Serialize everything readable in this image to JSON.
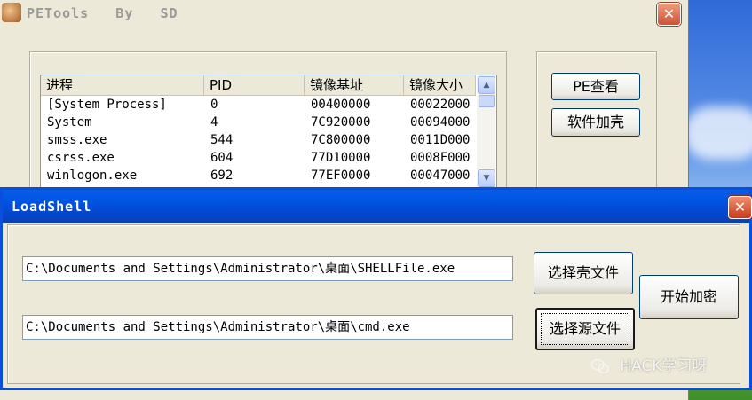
{
  "main_window": {
    "title": "PETools   By   SD",
    "close_glyph": "✕",
    "process_list": {
      "columns": [
        "进程",
        "PID",
        "镜像基址",
        "镜像大小"
      ],
      "rows": [
        [
          "[System Process]",
          "0",
          "00400000",
          "00022000"
        ],
        [
          "System",
          "4",
          "7C920000",
          "00094000"
        ],
        [
          "smss.exe",
          "544",
          "7C800000",
          "0011D000"
        ],
        [
          "csrss.exe",
          "604",
          "77D10000",
          "0008F000"
        ],
        [
          "winlogon.exe",
          "692",
          "77EF0000",
          "00047000"
        ]
      ]
    },
    "buttons": {
      "pe_view": "PE查看",
      "add_shell": "软件加壳"
    }
  },
  "dialog": {
    "title": "LoadShell",
    "close_glyph": "✕",
    "shell_path": "C:\\Documents and Settings\\Administrator\\桌面\\SHELLFile.exe",
    "source_path": "C:\\Documents and Settings\\Administrator\\桌面\\cmd.exe",
    "buttons": {
      "select_shell": "选择壳文件",
      "select_source": "选择源文件",
      "start_encrypt": "开始加密"
    }
  },
  "watermark": {
    "text": "HACK学习呀"
  },
  "icons": {
    "app": "dog-app-icon",
    "close": "close-icon",
    "scroll_up": "scroll-up-icon",
    "scroll_down": "scroll-down-icon",
    "watermark": "wechat-icon"
  },
  "colors": {
    "window_bg": "#ece9d8",
    "titlebar_blue": "#0058e6",
    "close_red": "#c9381a",
    "input_border": "#7f9db9"
  }
}
